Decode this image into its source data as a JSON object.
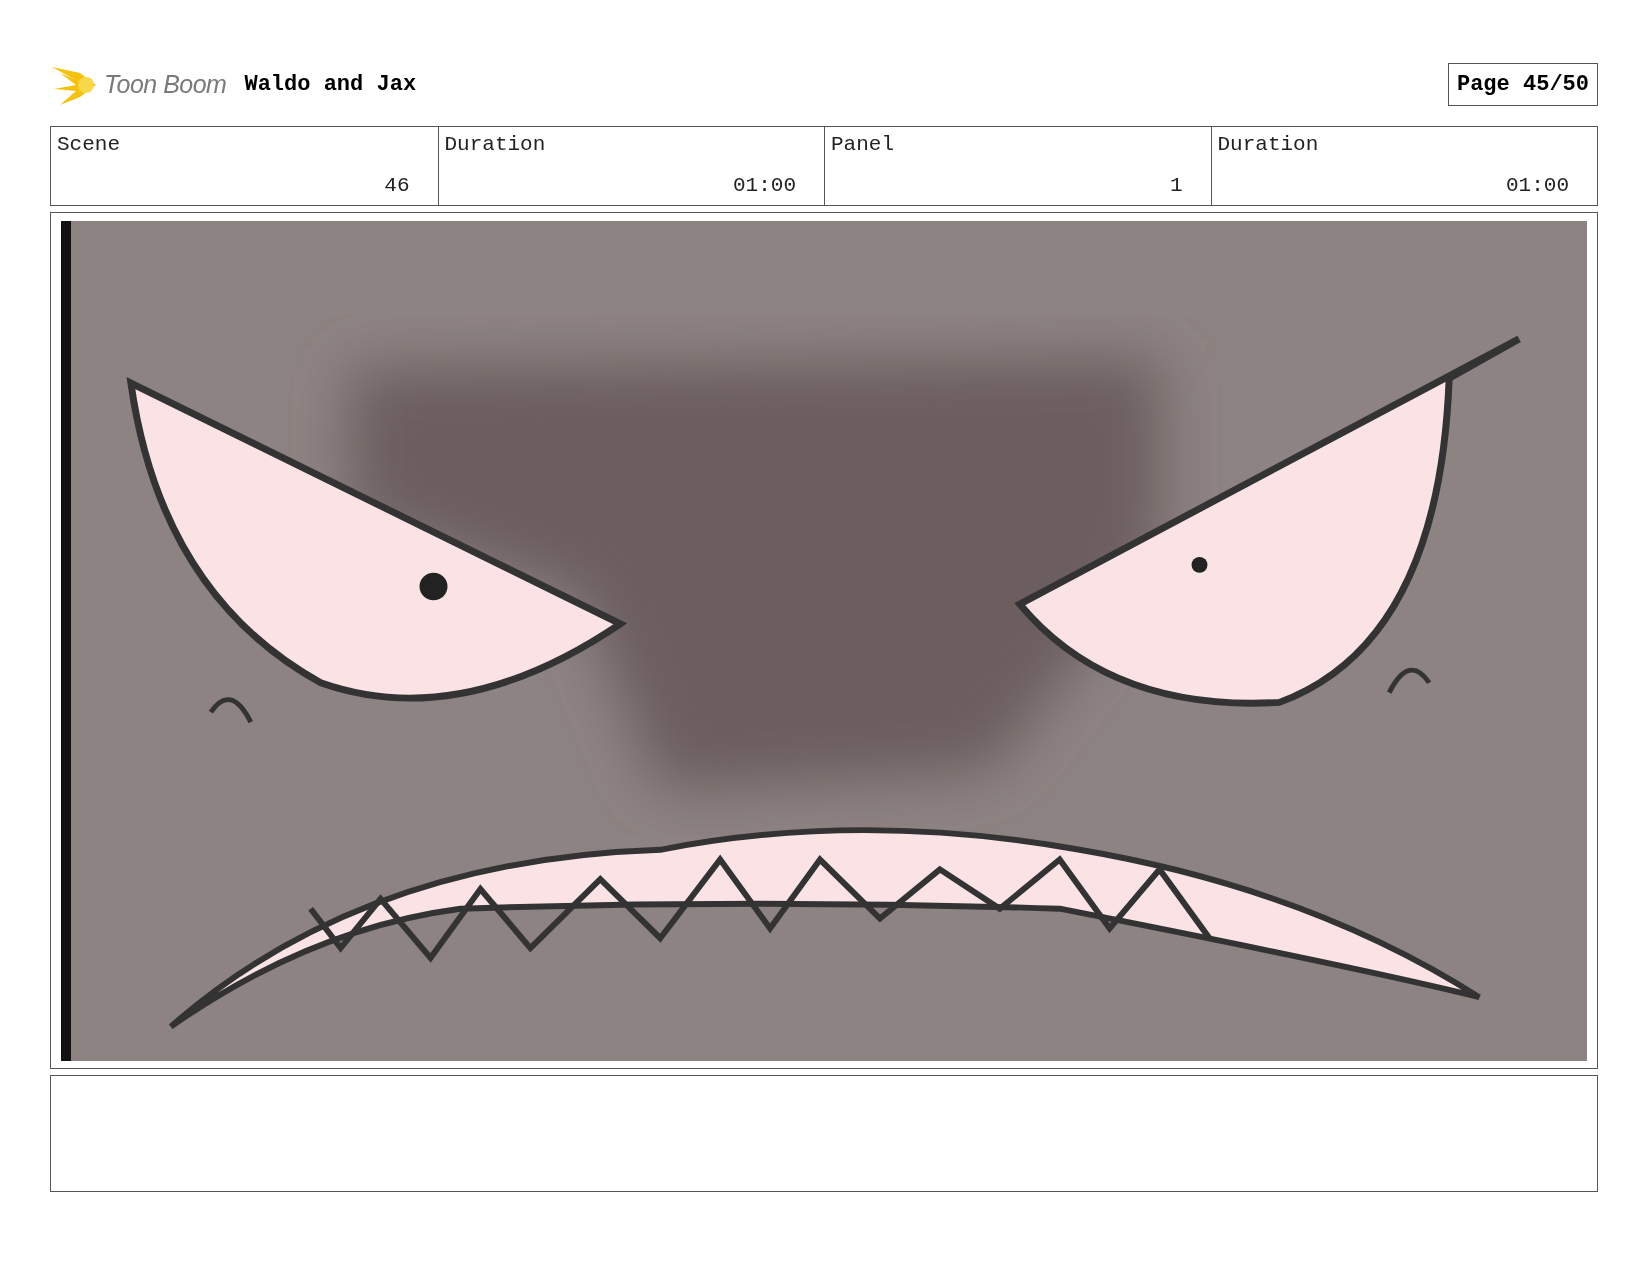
{
  "header": {
    "logo_text": "Toon Boom",
    "title": "Waldo and Jax",
    "page": "Page 45/50"
  },
  "info": [
    {
      "label": "Scene",
      "value": "46"
    },
    {
      "label": "Duration",
      "value": "01:00"
    },
    {
      "label": "Panel",
      "value": "1"
    },
    {
      "label": "Duration",
      "value": "01:00"
    }
  ]
}
